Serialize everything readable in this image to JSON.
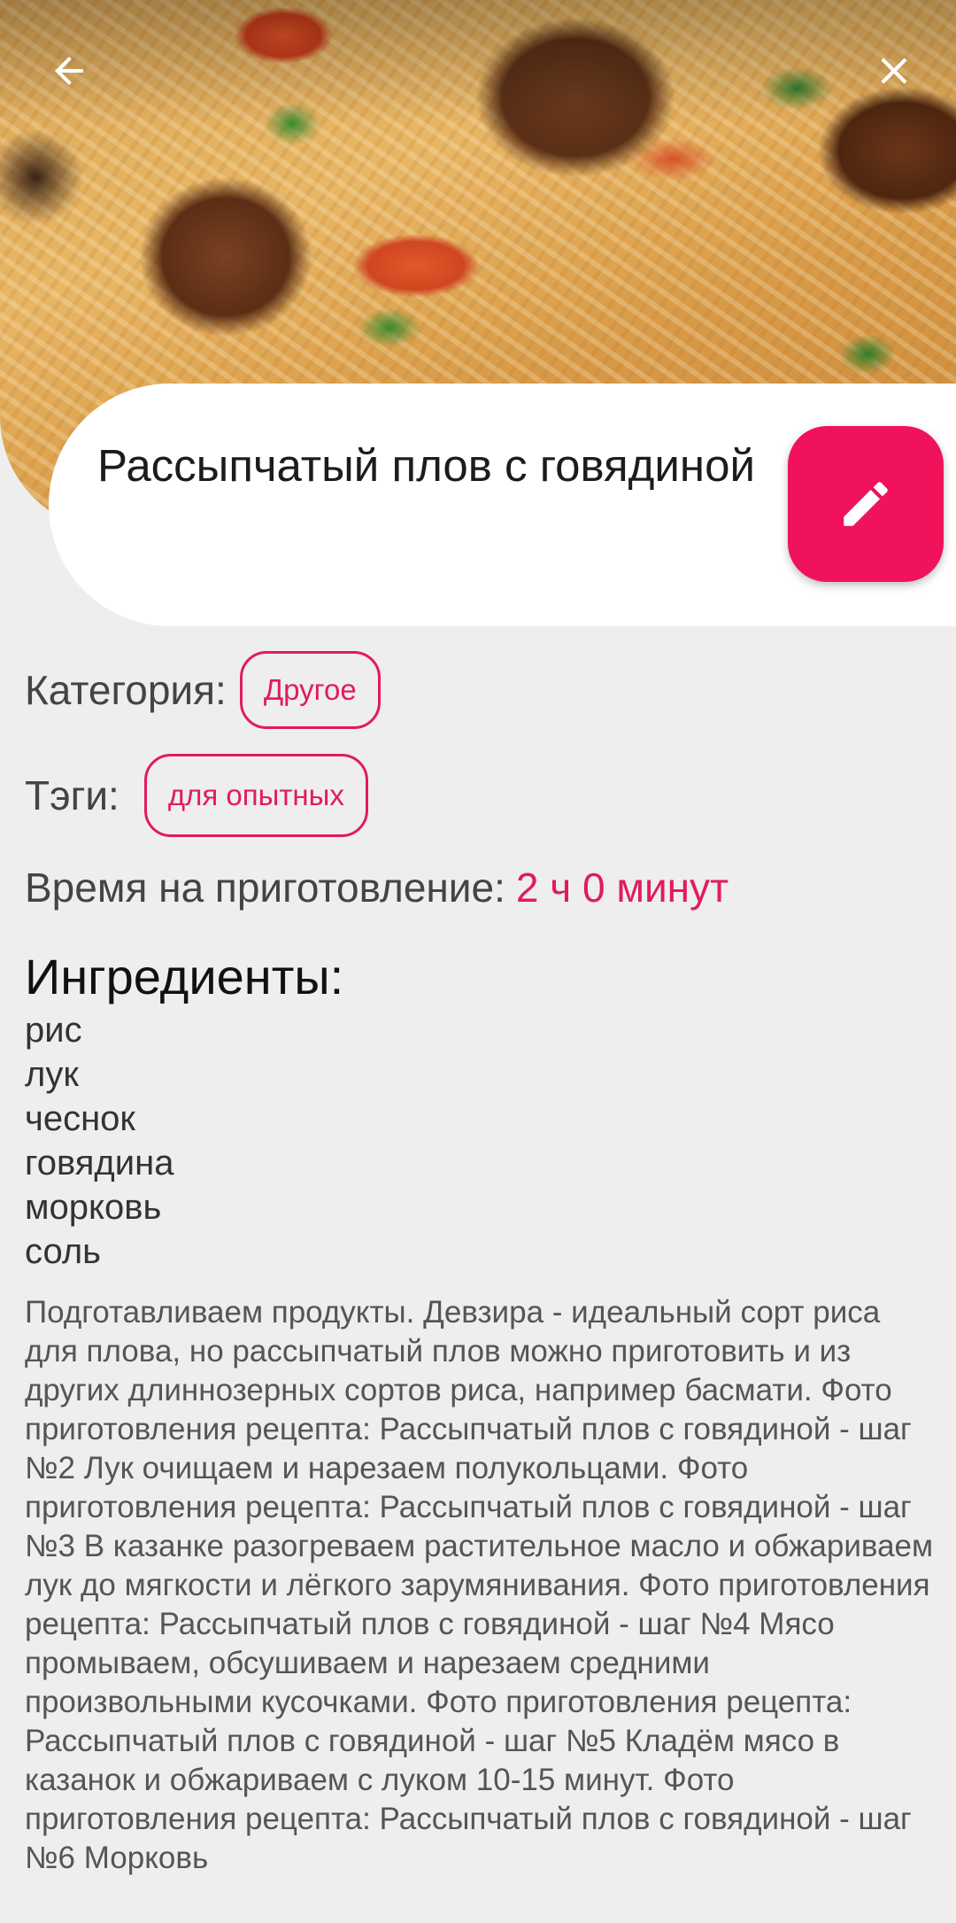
{
  "recipe": {
    "title": "Рассыпчатый плов с говядиной",
    "category_label": "Категория:",
    "category": "Другое",
    "tags_label": "Тэги:",
    "tags": [
      "для опытных"
    ],
    "time_label": "Время на приготовление:",
    "time_value": "2 ч 0 минут",
    "ingredients_title": "Ингредиенты:",
    "ingredients": [
      "рис",
      "лук",
      "чеснок",
      "говядина",
      "морковь",
      "соль"
    ],
    "description": "Подготавливаем продукты. Девзира - идеальный сорт риса для плова, но рассыпчатый плов можно приготовить и из других длиннозерных сортов риса, например басмати.  Фото приготовления рецепта: Рассыпчатый плов с говядиной - шаг №2 Лук очищаем и нарезаем полукольцами.  Фото приготовления рецепта: Рассыпчатый плов с говядиной - шаг №3 В казанке разогреваем растительное масло и обжариваем лук до мягкости и лёгкого зарумянивания.  Фото приготовления рецепта: Рассыпчатый плов с говядиной - шаг №4 Мясо промываем, обсушиваем и нарезаем средними произвольными кусочками.  Фото приготовления рецепта: Рассыпчатый плов с говядиной - шаг №5 Кладём мясо в казанок и обжариваем с луком 10-15 минут.  Фото приготовления рецепта: Рассыпчатый плов с говядиной - шаг №6 Морковь"
  },
  "icons": {
    "back": "arrow-left-icon",
    "close": "close-icon",
    "edit": "pencil-icon"
  },
  "colors": {
    "accent": "#f0125a",
    "chip": "#e11b5f",
    "background": "#eeeeee"
  }
}
